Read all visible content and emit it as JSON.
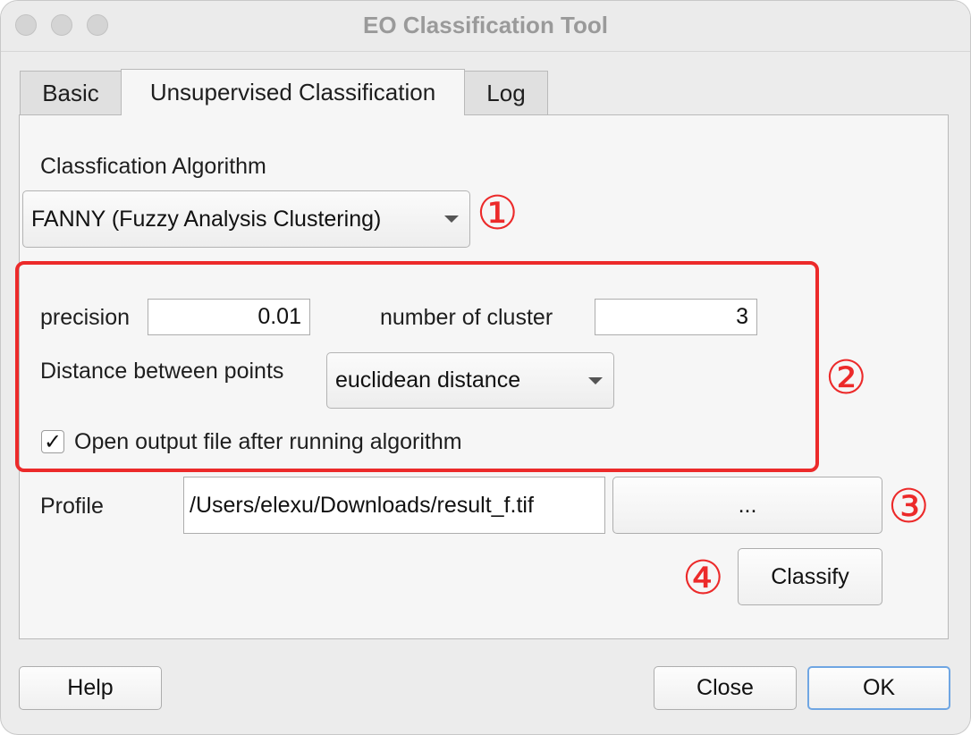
{
  "window": {
    "title": "EO Classification Tool"
  },
  "tabs": [
    {
      "label": "Basic",
      "active": false
    },
    {
      "label": "Unsupervised Classification",
      "active": true
    },
    {
      "label": "Log",
      "active": false
    }
  ],
  "algorithm": {
    "label": "Classfication Algorithm",
    "selected": "FANNY (Fuzzy Analysis Clustering)"
  },
  "params": {
    "precision_label": "precision",
    "precision_value": "0.01",
    "clusters_label": "number of cluster",
    "clusters_value": "3",
    "distance_label": "Distance between points",
    "distance_selected": "euclidean distance",
    "open_output_label": "Open output file after running algorithm",
    "open_output_checked": true,
    "check_glyph": "✓"
  },
  "profile": {
    "label": "Profile",
    "path": "/Users/elexu/Downloads/result_f.tif",
    "browse_label": "..."
  },
  "classify_label": "Classify",
  "footer": {
    "help_label": "Help",
    "close_label": "Close",
    "ok_label": "OK"
  },
  "annotations": {
    "m1": "①",
    "m2": "②",
    "m3": "③",
    "m4": "④",
    "color": "#ec2a2a"
  }
}
